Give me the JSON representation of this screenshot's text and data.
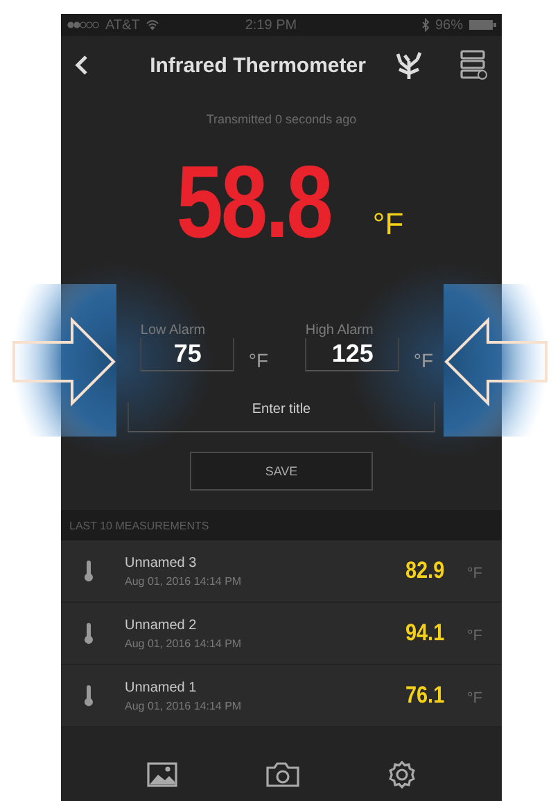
{
  "status_bar": {
    "carrier": "AT&T",
    "time": "2:19 PM",
    "battery": "96%"
  },
  "header": {
    "title": "Infrared Thermometer"
  },
  "transmitted": "Transmitted 0 seconds ago",
  "reading": {
    "value": "58.8",
    "unit": "°F"
  },
  "alarms": [
    {
      "label": "Low Alarm",
      "value": "75",
      "unit": "°F"
    },
    {
      "label": "High Alarm",
      "value": "125",
      "unit": "°F"
    }
  ],
  "title_field": {
    "placeholder": "Enter title"
  },
  "save_button": "SAVE",
  "measurements": {
    "heading": "LAST 10 MEASUREMENTS",
    "rows": [
      {
        "name": "Unnamed 3",
        "date": "Aug 01, 2016 14:14 PM",
        "value": "82.9",
        "unit": "°F"
      },
      {
        "name": "Unnamed 2",
        "date": "Aug 01, 2016 14:14 PM",
        "value": "94.1",
        "unit": "°F"
      },
      {
        "name": "Unnamed 1",
        "date": "Aug 01, 2016 14:14 PM",
        "value": "76.1",
        "unit": "°F"
      }
    ]
  }
}
